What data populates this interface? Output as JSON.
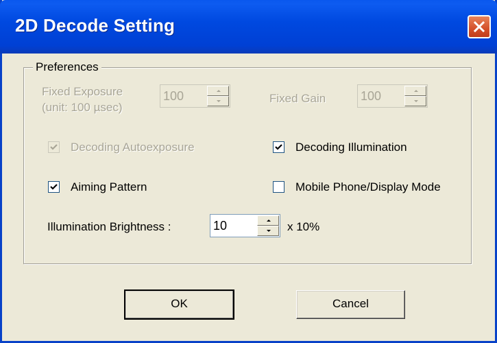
{
  "window": {
    "title": "2D Decode Setting"
  },
  "group": {
    "label": "Preferences"
  },
  "fixed_exposure": {
    "label_line1": "Fixed Exposure",
    "label_line2": "(unit: 100 µsec)",
    "value": "100"
  },
  "fixed_gain": {
    "label": "Fixed Gain",
    "value": "100"
  },
  "checkboxes": {
    "decoding_autoexposure": {
      "label": "Decoding Autoexposure",
      "checked": true,
      "enabled": false
    },
    "decoding_illumination": {
      "label": "Decoding Illumination",
      "checked": true,
      "enabled": true
    },
    "aiming_pattern": {
      "label": "Aiming Pattern",
      "checked": true,
      "enabled": true
    },
    "mobile_phone_display_mode": {
      "label": "Mobile Phone/Display Mode",
      "checked": false,
      "enabled": true
    }
  },
  "illumination_brightness": {
    "label": "Illumination Brightness :",
    "value": "10",
    "suffix": "x 10%"
  },
  "buttons": {
    "ok": "OK",
    "cancel": "Cancel"
  },
  "colors": {
    "titlebar": "#0046dc",
    "dialog_bg": "#ece9d8",
    "disabled_text": "#a8a596",
    "close_button": "#d4502a"
  }
}
